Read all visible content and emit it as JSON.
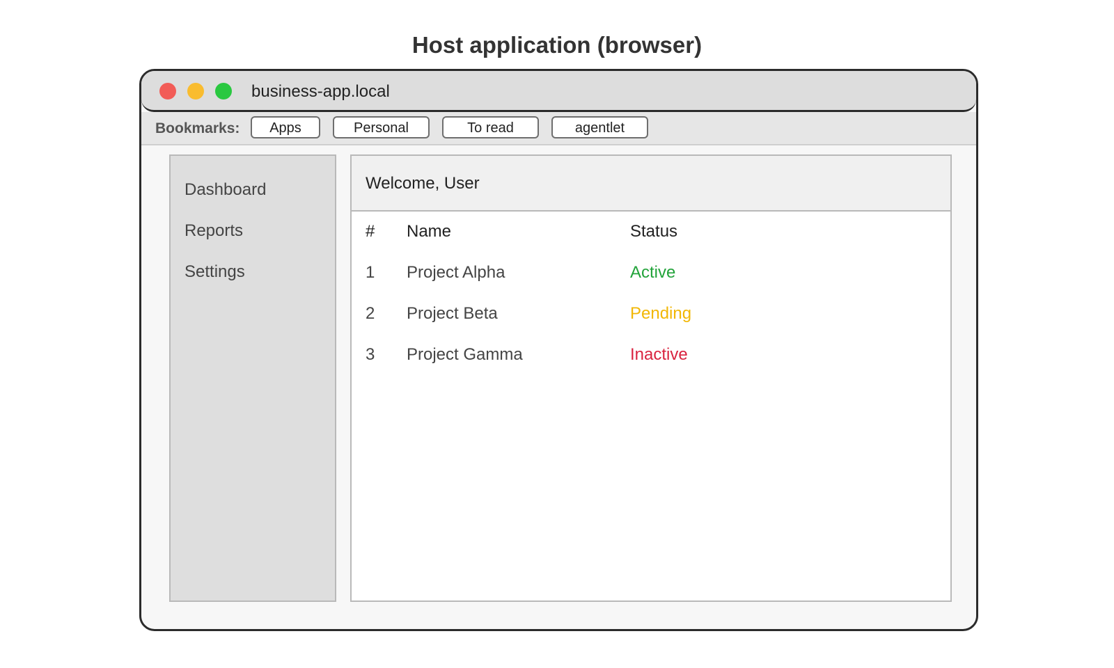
{
  "caption": "Host application (browser)",
  "window": {
    "url": "business-app.local",
    "traffic_lights": {
      "close_color": "#f25c57",
      "minimize_color": "#f9bc2f",
      "maximize_color": "#2ac840"
    }
  },
  "bookmarks": {
    "label": "Bookmarks:",
    "items": [
      "Apps",
      "Personal",
      "To read",
      "agentlet"
    ]
  },
  "sidebar": {
    "items": [
      "Dashboard",
      "Reports",
      "Settings"
    ]
  },
  "main": {
    "welcome": "Welcome, User",
    "table": {
      "headers": [
        "#",
        "Name",
        "Status"
      ],
      "rows": [
        {
          "num": "1",
          "name": "Project Alpha",
          "status": "Active",
          "status_color": "#22a33a"
        },
        {
          "num": "2",
          "name": "Project Beta",
          "status": "Pending",
          "status_color": "#f2b705"
        },
        {
          "num": "3",
          "name": "Project Gamma",
          "status": "Inactive",
          "status_color": "#d9233f"
        }
      ]
    }
  }
}
